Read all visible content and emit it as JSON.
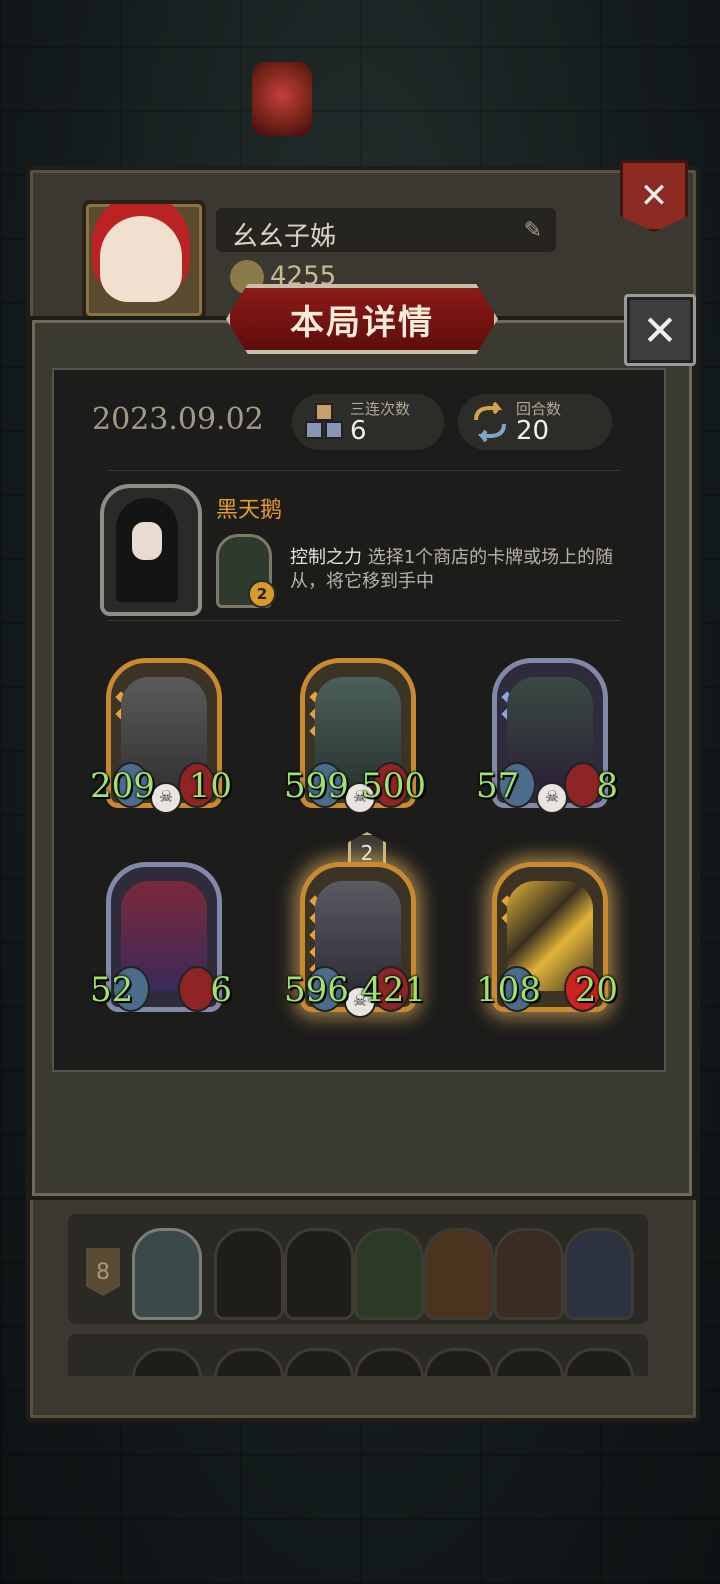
{
  "profile": {
    "player_name": "幺幺子姊",
    "coins": "4255"
  },
  "modal": {
    "title": "本局详情",
    "date": "2023.09.02",
    "triples": {
      "label": "三连次数",
      "value": "6"
    },
    "rounds": {
      "label": "回合数",
      "value": "20"
    }
  },
  "hero": {
    "name": "黑天鹅",
    "skill_level": "2",
    "skill_name": "控制之力",
    "skill_desc": "选择1个商店的卡牌或场上的随从，将它移到手中"
  },
  "cards": [
    {
      "attack": "209",
      "health": "10",
      "frame": "gold",
      "art": "cube-robot"
    },
    {
      "attack": "599",
      "health": "500",
      "frame": "gold",
      "art": "armored-knight"
    },
    {
      "attack": "57",
      "health": "8",
      "frame": "silver",
      "art": "demon-girl"
    },
    {
      "attack": "52",
      "health": "6",
      "frame": "silver",
      "art": "jester-clown"
    },
    {
      "attack": "596",
      "health": "421",
      "frame": "gold",
      "art": "gold-mech",
      "level": "2"
    },
    {
      "attack": "108",
      "health": "20",
      "frame": "gold",
      "art": "lightning-cannon"
    }
  ],
  "roster": {
    "rank": "8"
  },
  "colors": {
    "title_plate": "#8c1a18",
    "attack_text": "#9ee36a",
    "hero_name": "#e39b32"
  }
}
